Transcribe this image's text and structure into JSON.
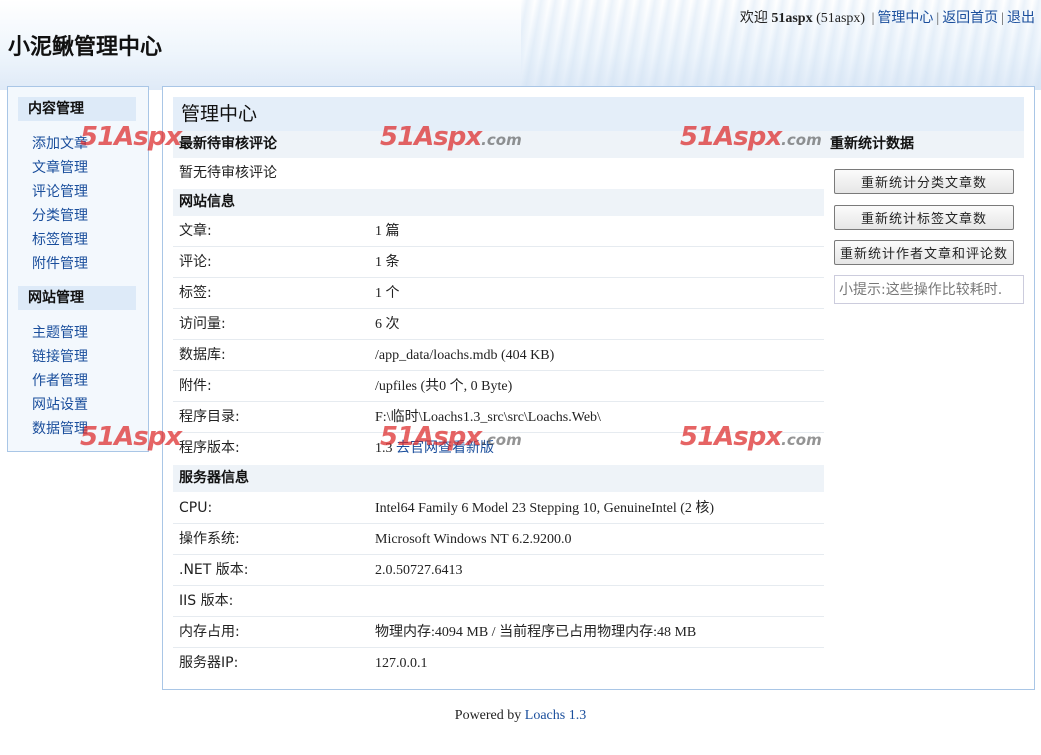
{
  "header": {
    "site_title": "小泥鳅管理中心",
    "welcome_prefix": "欢迎",
    "username": "51aspx",
    "username_paren": "(51aspx)",
    "separator": "|",
    "link_admin": "管理中心",
    "link_home": "返回首页",
    "link_logout": "退出"
  },
  "sidebar": {
    "content_title": "内容管理",
    "content_items": [
      "添加文章",
      "文章管理",
      "评论管理",
      "分类管理",
      "标签管理",
      "附件管理"
    ],
    "site_title": "网站管理",
    "site_items": [
      "主题管理",
      "链接管理",
      "作者管理",
      "网站设置",
      "数据管理"
    ]
  },
  "main": {
    "title": "管理中心",
    "pending_title": "最新待审核评论",
    "pending_text": "暂无待审核评论",
    "site_info_title": "网站信息",
    "site_info": [
      {
        "label": "文章:",
        "value": "1 篇"
      },
      {
        "label": "评论:",
        "value": "1 条"
      },
      {
        "label": "标签:",
        "value": "1 个"
      },
      {
        "label": "访问量:",
        "value": "6 次"
      },
      {
        "label": "数据库:",
        "value": "/app_data/loachs.mdb (404 KB)"
      },
      {
        "label": "附件:",
        "value": "/upfiles (共0 个, 0 Byte)"
      },
      {
        "label": "程序目录:",
        "value": "F:\\临时\\Loachs1.3_src\\src\\Loachs.Web\\"
      },
      {
        "label": "程序版本:",
        "value": "1.3",
        "link": "去官网查看新版"
      }
    ],
    "server_info_title": "服务器信息",
    "server_info": [
      {
        "label": "CPU:",
        "value": "Intel64 Family 6 Model 23 Stepping 10, GenuineIntel (2 核)"
      },
      {
        "label": "操作系统:",
        "value": "Microsoft Windows NT 6.2.9200.0"
      },
      {
        "label": ".NET 版本:",
        "value": "2.0.50727.6413"
      },
      {
        "label": "IIS 版本:",
        "value": ""
      },
      {
        "label": "内存占用:",
        "value": "物理内存:4094 MB / 当前程序已占用物理内存:48 MB"
      },
      {
        "label": "服务器IP:",
        "value": "127.0.0.1"
      }
    ]
  },
  "right_panel": {
    "title": "重新统计数据",
    "buttons": [
      "重新统计分类文章数",
      "重新统计标签文章数",
      "重新统计作者文章和评论数"
    ],
    "tip": "小提示:这些操作比较耗时."
  },
  "footer": {
    "powered_by": "Powered by",
    "link": "Loachs 1.3"
  },
  "watermark": {
    "brand": "51Aspx",
    "suffix": ".com"
  }
}
